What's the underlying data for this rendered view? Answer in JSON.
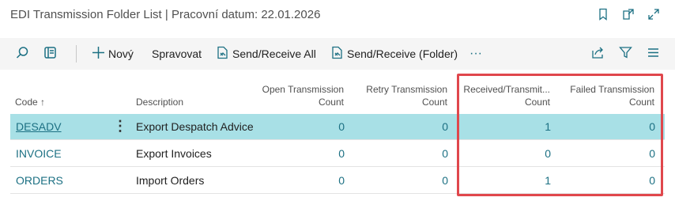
{
  "window": {
    "title": "EDI Transmission Folder List | Pracovní datum: 22.01.2026",
    "icons": [
      "bookmark-icon",
      "open-in-new-window-icon",
      "expand-icon"
    ]
  },
  "toolbar": {
    "search_icon": "search-icon",
    "filter_pane_icon": "filter-pane-icon",
    "new_label": "Nový",
    "manage_label": "Spravovat",
    "send_receive_all_label": "Send/Receive All",
    "send_receive_folder_label": "Send/Receive (Folder)",
    "more_label": "···",
    "share_icon": "share-icon",
    "filter_icon": "filter-icon",
    "list_view_icon": "list-view-icon"
  },
  "table": {
    "headers": {
      "code": "Code",
      "code_sort": "↑",
      "description": "Description",
      "open_1": "Open Transmission",
      "open_2": "Count",
      "retry_1": "Retry Transmission",
      "retry_2": "Count",
      "received_1": "Received/Transmit...",
      "received_2": "Count",
      "failed_1": "Failed Transmission",
      "failed_2": "Count"
    },
    "rows": [
      {
        "code": "DESADV",
        "description": "Export Despatch Advice",
        "open": "0",
        "retry": "0",
        "received": "1",
        "failed": "0",
        "selected": true
      },
      {
        "code": "INVOICE",
        "description": "Export Invoices",
        "open": "0",
        "retry": "0",
        "received": "0",
        "failed": "0",
        "selected": false
      },
      {
        "code": "ORDERS",
        "description": "Import Orders",
        "open": "0",
        "retry": "0",
        "received": "1",
        "failed": "0",
        "selected": false
      }
    ],
    "row_menu": "⋮"
  },
  "colors": {
    "accent": "#1c7083",
    "selected_row": "#a8e0e6",
    "highlight_border": "#e0474c"
  }
}
